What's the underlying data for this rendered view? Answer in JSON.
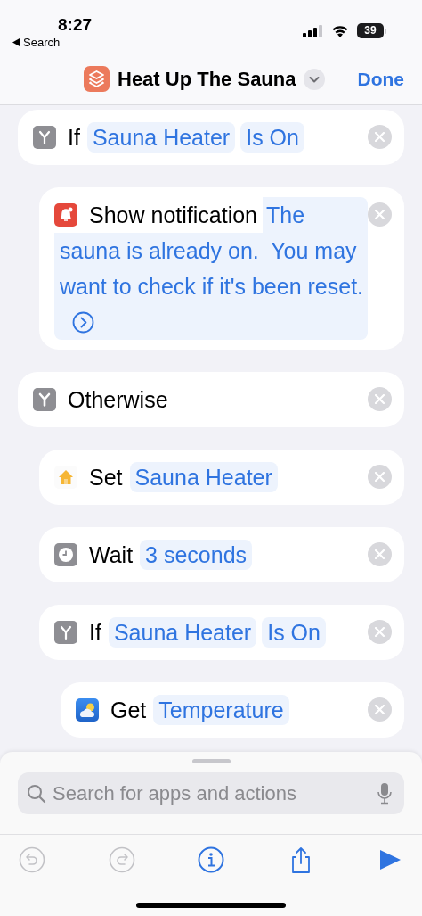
{
  "status_bar": {
    "time": "8:27",
    "back": "Search",
    "battery": "39"
  },
  "header": {
    "title": "Heat Up The Sauna",
    "done": "Done"
  },
  "actions": [
    {
      "kind": "if",
      "label": "If",
      "parts": [
        {
          "kind": "param",
          "text": "Sauna Heater"
        },
        {
          "kind": "param",
          "text": "Is On"
        }
      ],
      "children": [
        {
          "kind": "notification",
          "label": "Show notification",
          "parts": [
            {
              "kind": "param",
              "text": "The sauna is already on.  You may want to check if it's been reset."
            }
          ],
          "expandable": true
        }
      ]
    },
    {
      "kind": "otherwise",
      "label": "Otherwise",
      "children": [
        {
          "kind": "set",
          "label": "Set",
          "parts": [
            {
              "kind": "param",
              "text": "Sauna Heater"
            }
          ]
        },
        {
          "kind": "wait",
          "label": "Wait",
          "parts": [
            {
              "kind": "param",
              "text": "3 seconds"
            }
          ]
        },
        {
          "kind": "if",
          "label": "If",
          "parts": [
            {
              "kind": "param",
              "text": "Sauna Heater"
            },
            {
              "kind": "param",
              "text": "Is On"
            }
          ],
          "children": [
            {
              "kind": "get",
              "label": "Get",
              "parts": [
                {
                  "kind": "param",
                  "text": "Temperature"
                }
              ]
            }
          ]
        }
      ]
    }
  ],
  "search": {
    "placeholder": "Search for apps and actions"
  },
  "toolbar": [
    {
      "kind": "undo",
      "disabled": true
    },
    {
      "kind": "redo",
      "disabled": true
    },
    {
      "kind": "info",
      "disabled": false
    },
    {
      "kind": "share",
      "disabled": false
    },
    {
      "kind": "run",
      "disabled": false
    }
  ]
}
